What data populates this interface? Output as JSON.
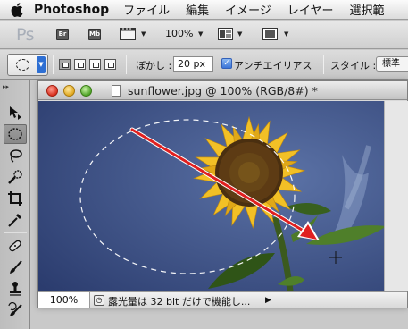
{
  "menubar": {
    "app_name": "Photoshop",
    "items": [
      "ファイル",
      "編集",
      "イメージ",
      "レイヤー",
      "選択範"
    ]
  },
  "appbar": {
    "logo": "Ps",
    "bridge": "Br",
    "minibridge": "Mb",
    "zoom": "100%"
  },
  "options": {
    "feather_label": "ぼかし :",
    "feather_value": "20 px",
    "antialias_label": "アンチエイリアス",
    "antialias_checked": true,
    "style_label": "スタイル :",
    "style_value": "標準"
  },
  "document": {
    "title": "sunflower.jpg @ 100% (RGB/8#) *",
    "zoom": "100%",
    "status": "露光量は 32 bit だけで機能し..."
  },
  "colors": {
    "accent": "#2e6fd3",
    "arrow": "#e02020",
    "sky": "#3a5188"
  }
}
